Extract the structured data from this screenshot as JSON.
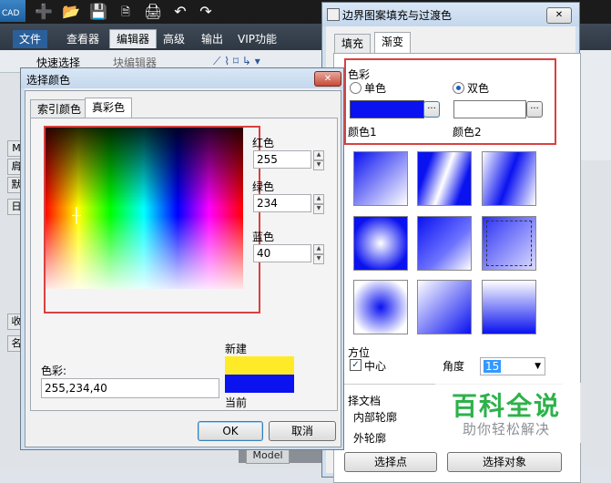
{
  "app": {
    "logo_text": "CAD",
    "ribbon_tabs": [
      "文件",
      "查看器",
      "编辑器",
      "高级",
      "输出",
      "VIP功能"
    ],
    "active_tab_index": 2,
    "ribbon_buttons": [
      "快速选择",
      "块编辑器"
    ],
    "left_tabs": [
      "M",
      "肩",
      "默",
      "日",
      "收",
      "名"
    ],
    "model_tab": "Model"
  },
  "color_dialog": {
    "title": "选择颜色",
    "tabs": [
      "索引颜色",
      "真彩色"
    ],
    "active_tab": 1,
    "red_label": "红色",
    "red_value": "255",
    "green_label": "绿色",
    "green_value": "234",
    "blue_label": "蓝色",
    "blue_value": "40",
    "color_label": "色彩:",
    "color_value": "255,234,40",
    "new_label": "新建",
    "current_label": "当前",
    "new_color": "#ffea28",
    "current_color": "#0a12f0",
    "ok_label": "OK",
    "cancel_label": "取消",
    "close_glyph": "✕"
  },
  "hatch_dialog": {
    "title": "边界图案填充与过渡色",
    "tabs": [
      "填充",
      "渐变"
    ],
    "active_tab": 1,
    "color_section": "色彩",
    "single_label": "单色",
    "double_label": "双色",
    "selected_mode": "双色",
    "color1_label": "颜色1",
    "color2_label": "颜色2",
    "color1": "#0a12f0",
    "browse_glyph": "...",
    "position_section": "方位",
    "center_label": "中心",
    "center_checked": true,
    "angle_label": "角度",
    "angle_value": "15",
    "boundary_section": "择文档",
    "inner_outline": "内部轮廓",
    "outer_outline": "外轮廓",
    "pick_points": "选择点",
    "select_objects": "选择对象",
    "close_glyph": "✕"
  },
  "watermark": {
    "title": "百科全说",
    "subtitle": "助你轻松解决"
  }
}
